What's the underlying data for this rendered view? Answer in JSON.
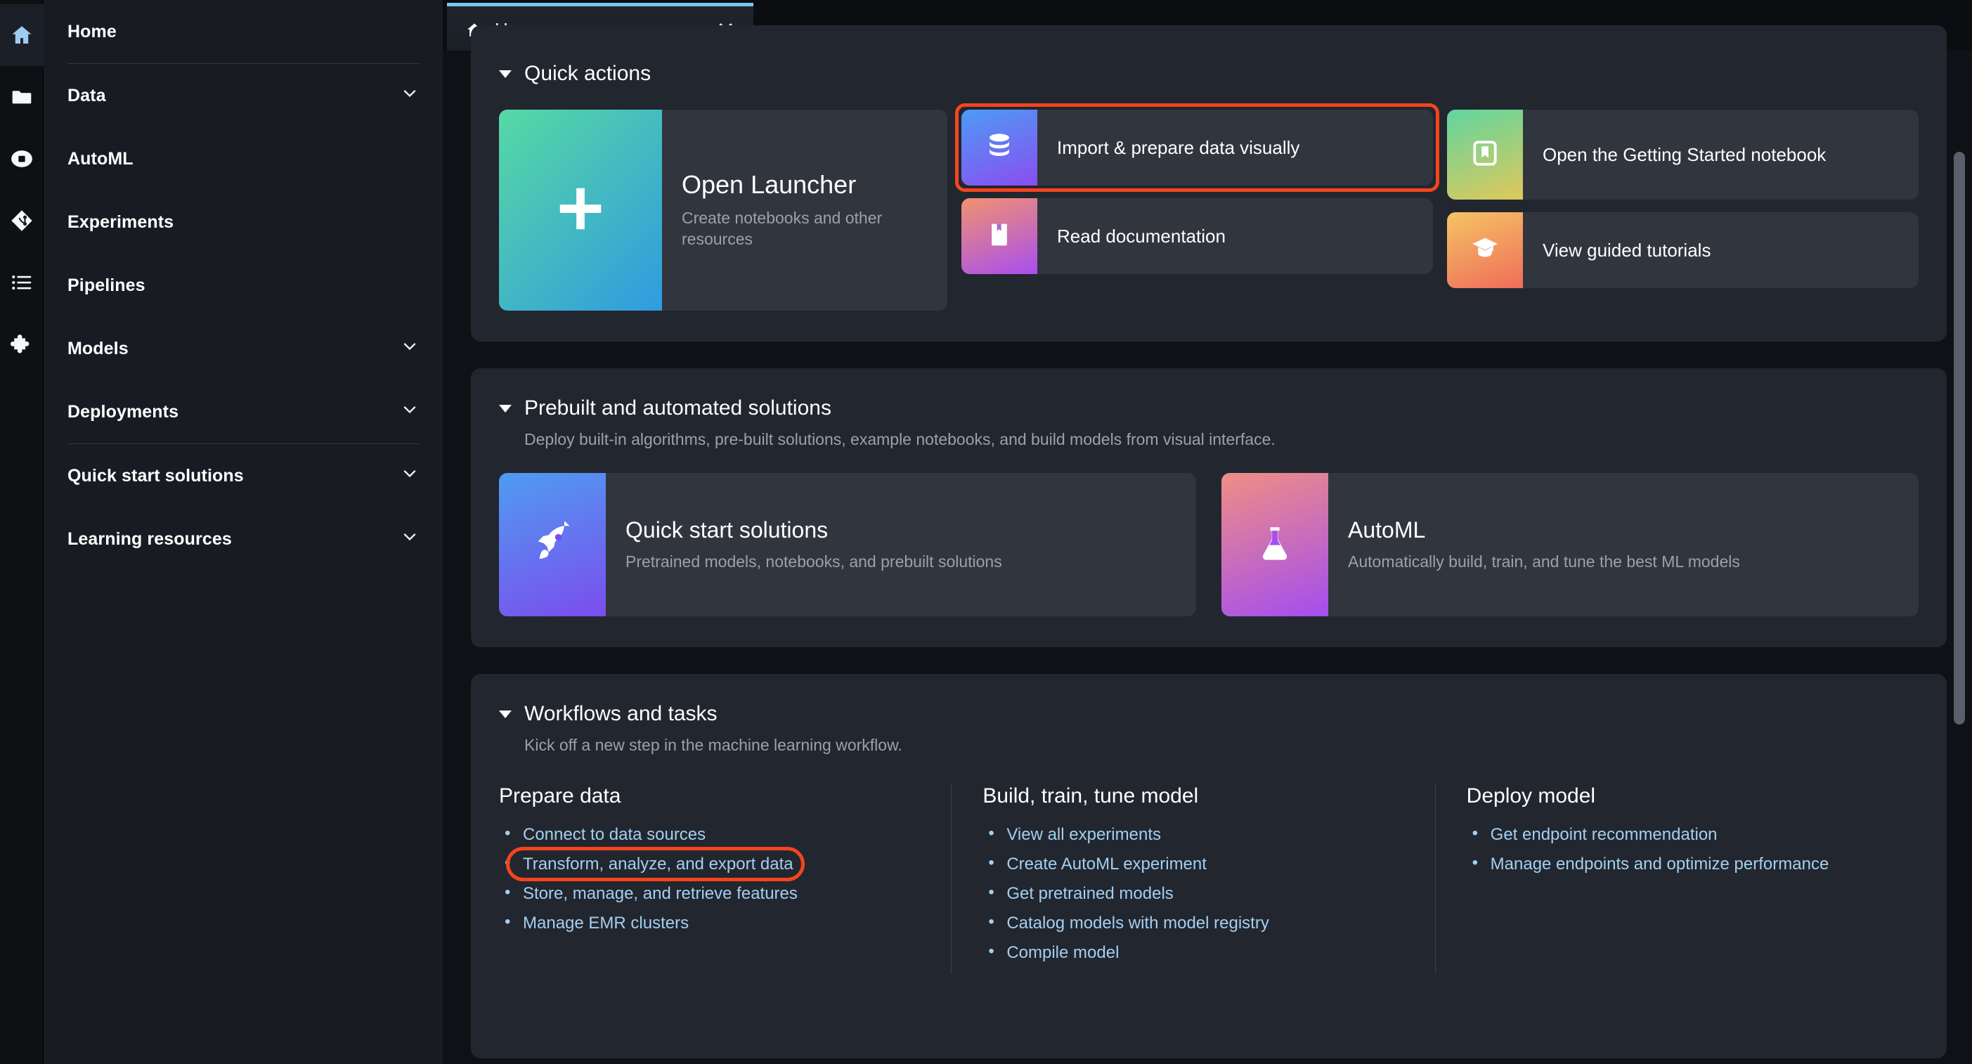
{
  "rail": {
    "items": [
      {
        "name": "home-icon",
        "label": "Home",
        "active": true
      },
      {
        "name": "file-browser-icon",
        "label": "File Browser",
        "active": false
      },
      {
        "name": "running-terminals-icon",
        "label": "Running Terminals and Kernels",
        "active": false
      },
      {
        "name": "git-icon",
        "label": "Git",
        "active": false
      },
      {
        "name": "command-palette-icon",
        "label": "Commands",
        "active": false
      },
      {
        "name": "extensions-icon",
        "label": "Extension Manager",
        "active": false
      }
    ]
  },
  "sidebar": {
    "items": [
      {
        "label": "Home",
        "expandable": false
      },
      {
        "label": "Data",
        "expandable": true
      },
      {
        "label": "AutoML",
        "expandable": false
      },
      {
        "label": "Experiments",
        "expandable": false
      },
      {
        "label": "Pipelines",
        "expandable": false
      },
      {
        "label": "Models",
        "expandable": true
      },
      {
        "label": "Deployments",
        "expandable": true
      },
      {
        "label": "Quick start solutions",
        "expandable": true
      },
      {
        "label": "Learning resources",
        "expandable": true
      }
    ]
  },
  "tab": {
    "label": "Home",
    "close": "✕"
  },
  "quick_actions": {
    "heading": "Quick actions",
    "launcher": {
      "title": "Open Launcher",
      "desc": "Create notebooks and other resources",
      "icon": "plus-icon",
      "gradient_from": "#57d9a3",
      "gradient_to": "#2f9be0"
    },
    "cards": [
      {
        "title": "Import & prepare data visually",
        "icon": "database-icon",
        "gradient_from": "#4b9cf5",
        "gradient_to": "#8b4df0",
        "highlighted": true
      },
      {
        "title": "Read documentation",
        "icon": "book-icon",
        "gradient_from": "#f2926e",
        "gradient_to": "#a84ef0",
        "highlighted": false
      },
      {
        "title": "Open the Getting Started notebook",
        "icon": "bookmark-icon",
        "gradient_from": "#5fd6a0",
        "gradient_to": "#e0c85a",
        "highlighted": false
      },
      {
        "title": "View guided tutorials",
        "icon": "graduation-cap-icon",
        "gradient_from": "#f5c464",
        "gradient_to": "#ef6d5a",
        "highlighted": false
      }
    ]
  },
  "prebuilt": {
    "heading": "Prebuilt and automated solutions",
    "sub": "Deploy built-in algorithms, pre-built solutions, example notebooks, and build models from visual interface.",
    "cards": [
      {
        "title": "Quick start solutions",
        "desc": "Pretrained models, notebooks, and prebuilt solutions",
        "icon": "rocket-icon",
        "gradient_from": "#4f9cf0",
        "gradient_to": "#7b4dee"
      },
      {
        "title": "AutoML",
        "desc": "Automatically build, train, and tune the best ML models",
        "icon": "flask-icon",
        "gradient_from": "#ef8e84",
        "gradient_to": "#a44df0"
      }
    ]
  },
  "workflows": {
    "heading": "Workflows and tasks",
    "sub": "Kick off a new step in the machine learning workflow.",
    "columns": [
      {
        "title": "Prepare data",
        "links": [
          {
            "label": "Connect to data sources",
            "highlighted": false
          },
          {
            "label": "Transform, analyze, and export data",
            "highlighted": true
          },
          {
            "label": "Store, manage, and retrieve features",
            "highlighted": false
          },
          {
            "label": "Manage EMR clusters",
            "highlighted": false
          }
        ]
      },
      {
        "title": "Build, train, tune model",
        "links": [
          {
            "label": "View all experiments",
            "highlighted": false
          },
          {
            "label": "Create AutoML experiment",
            "highlighted": false
          },
          {
            "label": "Get pretrained models",
            "highlighted": false
          },
          {
            "label": "Catalog models with model registry",
            "highlighted": false
          },
          {
            "label": "Compile model",
            "highlighted": false
          }
        ]
      },
      {
        "title": "Deploy model",
        "links": [
          {
            "label": "Get endpoint recommendation",
            "highlighted": false
          },
          {
            "label": "Manage endpoints and optimize performance",
            "highlighted": false
          }
        ]
      }
    ]
  },
  "colors": {
    "highlight": "#f4441e",
    "link": "#a3cff0",
    "panel": "#22262f",
    "card": "#31353e",
    "tab_accent": "#7cc5f0"
  }
}
